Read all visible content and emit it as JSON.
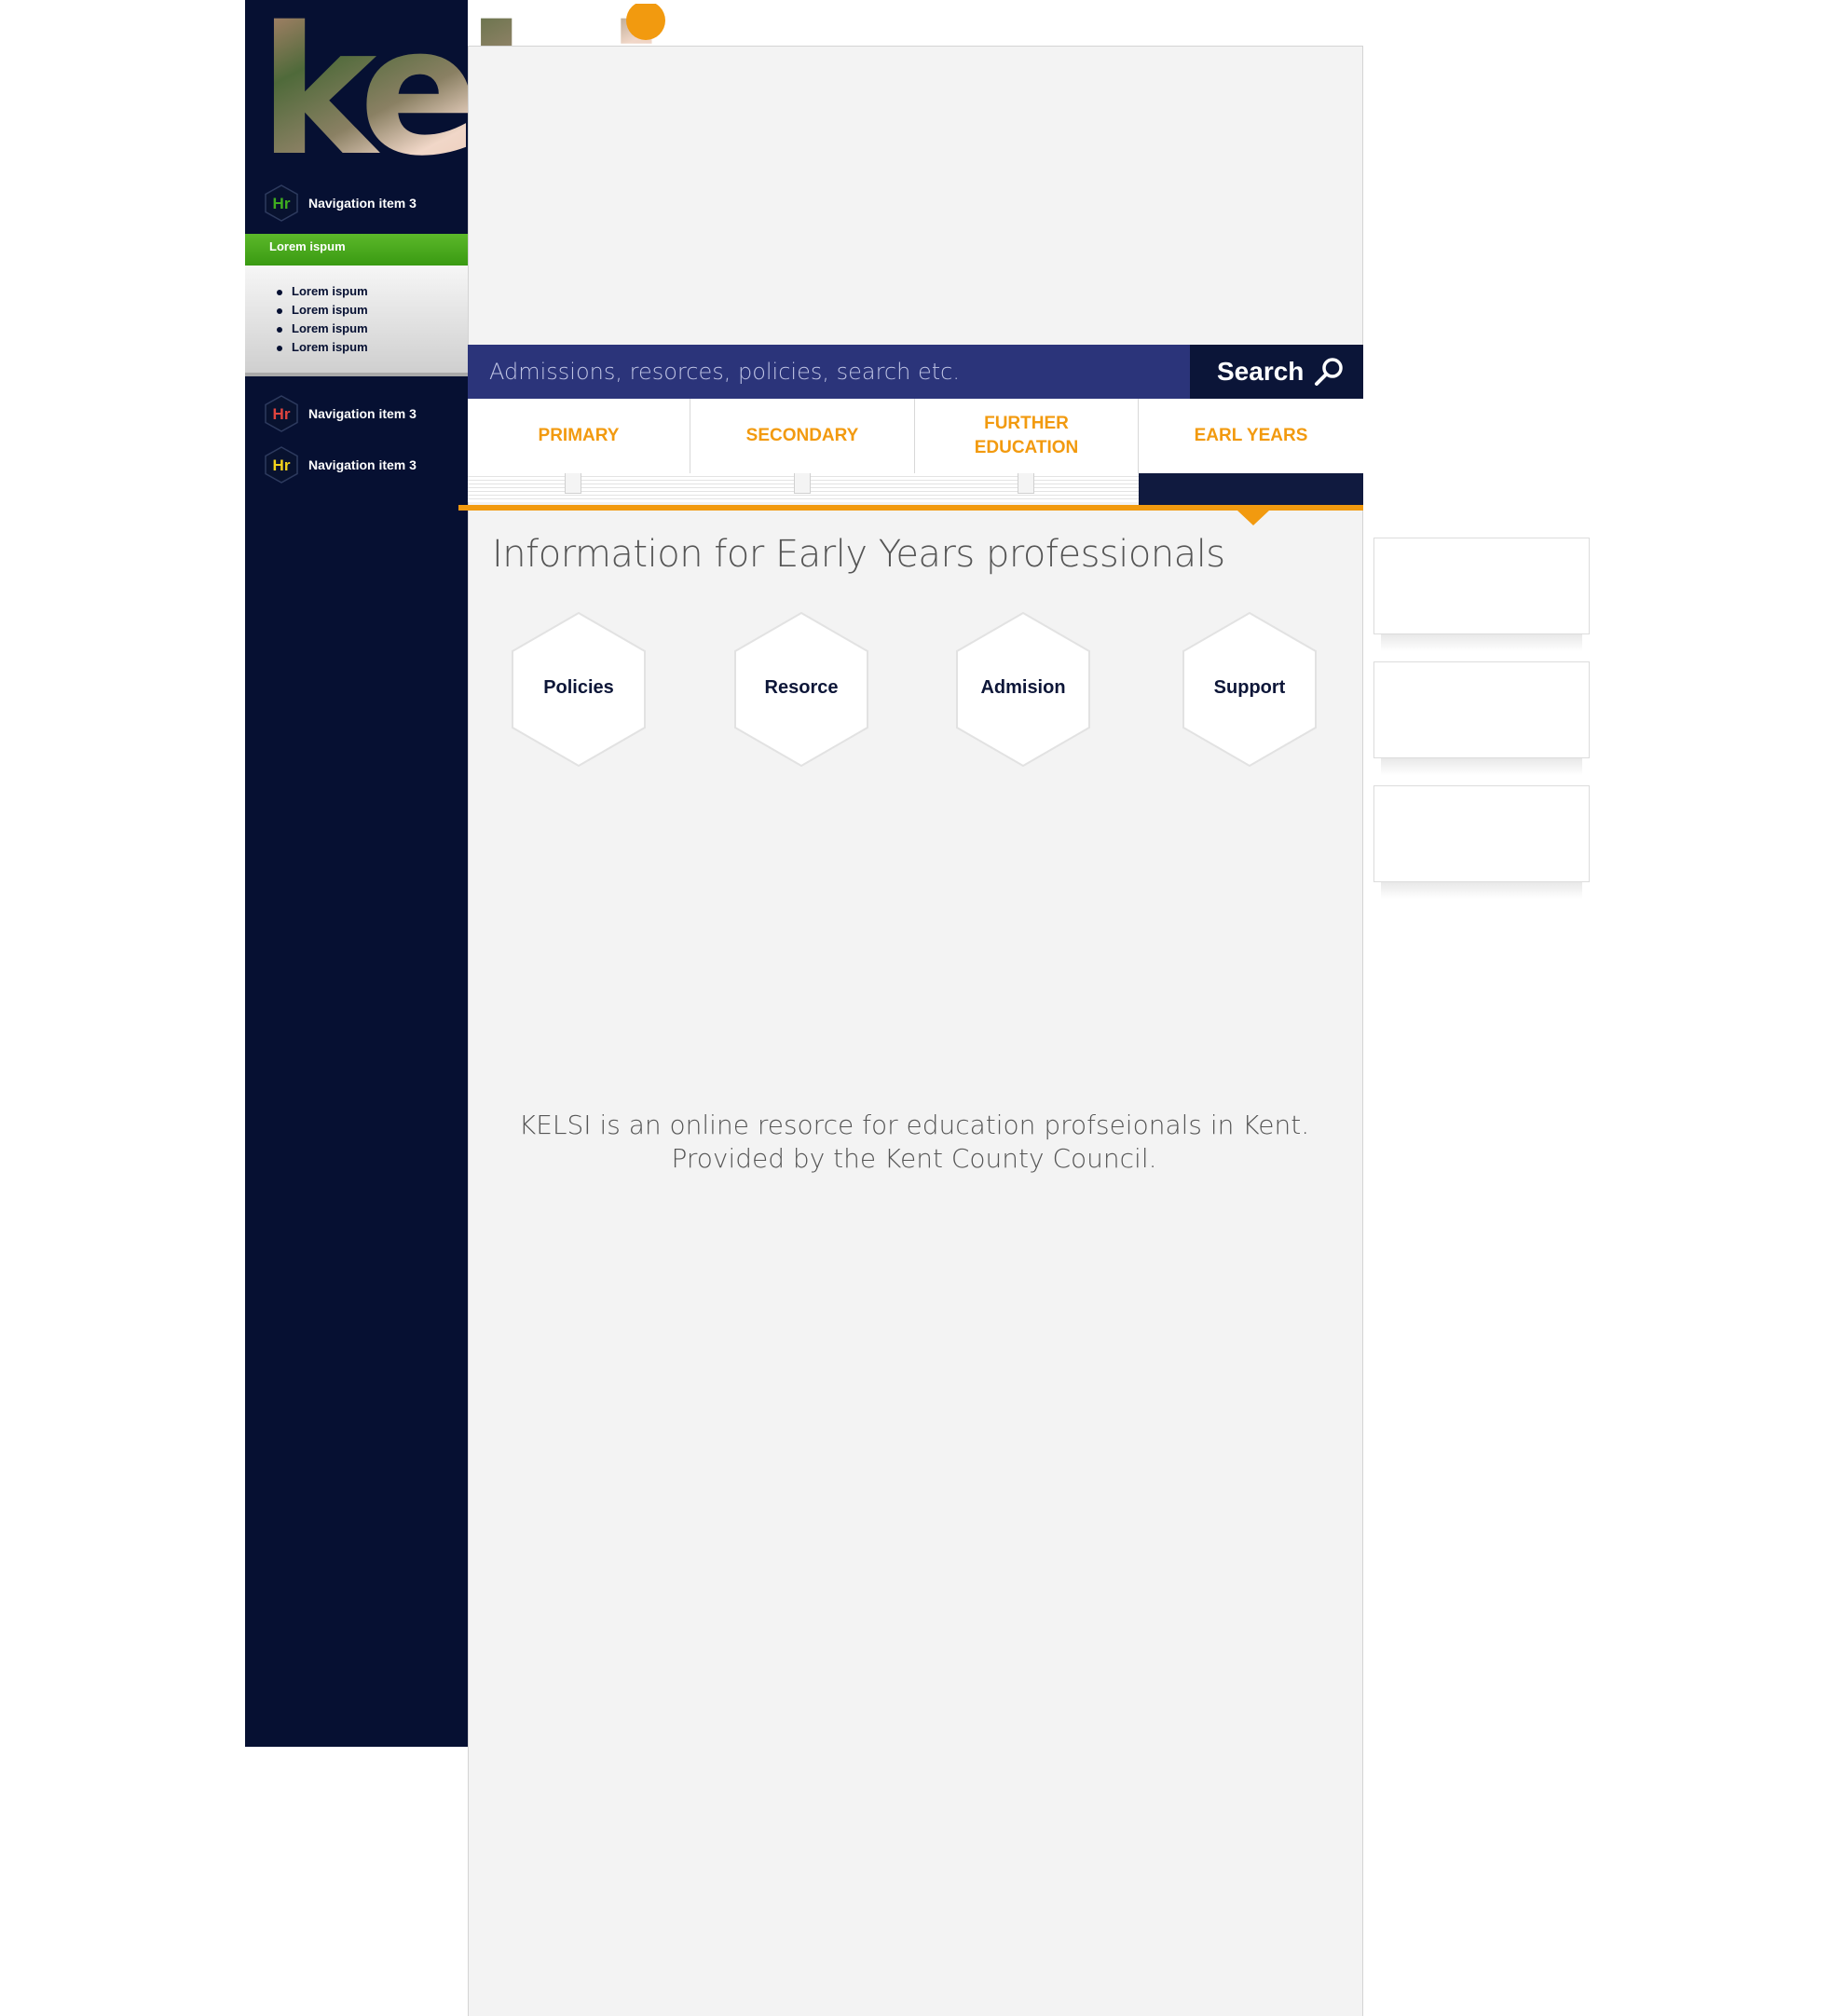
{
  "brand": {
    "logo_text": "kelsi",
    "dot_color": "#F29A0F"
  },
  "colors": {
    "sidebar": "#061032",
    "search_bar": "#2B347A",
    "accent": "#F29A0F",
    "submenu_green": "#4AAE1A",
    "panel_background": "#F3F3F3"
  },
  "sidebar": {
    "items": [
      {
        "icon": "hr-hexagon-icon",
        "icon_text": "Hr",
        "icon_color": "#3FAE1F",
        "label": "Navigation item 3"
      },
      {
        "icon": "hr-hexagon-icon",
        "icon_text": "Hr",
        "icon_color": "#E0443E",
        "label": "Navigation item 3"
      },
      {
        "icon": "hr-hexagon-icon",
        "icon_text": "Hr",
        "icon_color": "#F2D21B",
        "label": "Navigation item 3"
      }
    ],
    "submenu": {
      "title": "Lorem ispum",
      "items": [
        "Lorem ispum",
        "Lorem ispum",
        "Lorem ispum",
        "Lorem ispum"
      ]
    }
  },
  "search": {
    "placeholder": "Admissions, resorces, policies, search etc.",
    "button_label": "Search",
    "button_icon": "search-icon"
  },
  "tabs": [
    {
      "label": "PRIMARY",
      "active": false
    },
    {
      "label": "SECONDARY",
      "active": false
    },
    {
      "label": "FURTHER EDUCATION",
      "active": false
    },
    {
      "label": "EARL YEARS",
      "active": true
    }
  ],
  "main": {
    "heading": "Information for Early Years professionals",
    "cards": [
      "Policies",
      "Resorce",
      "Admision",
      "Support"
    ],
    "about": "KELSI is an online resorce for education profseionals in Kent. Provided by the Kent County Council."
  }
}
